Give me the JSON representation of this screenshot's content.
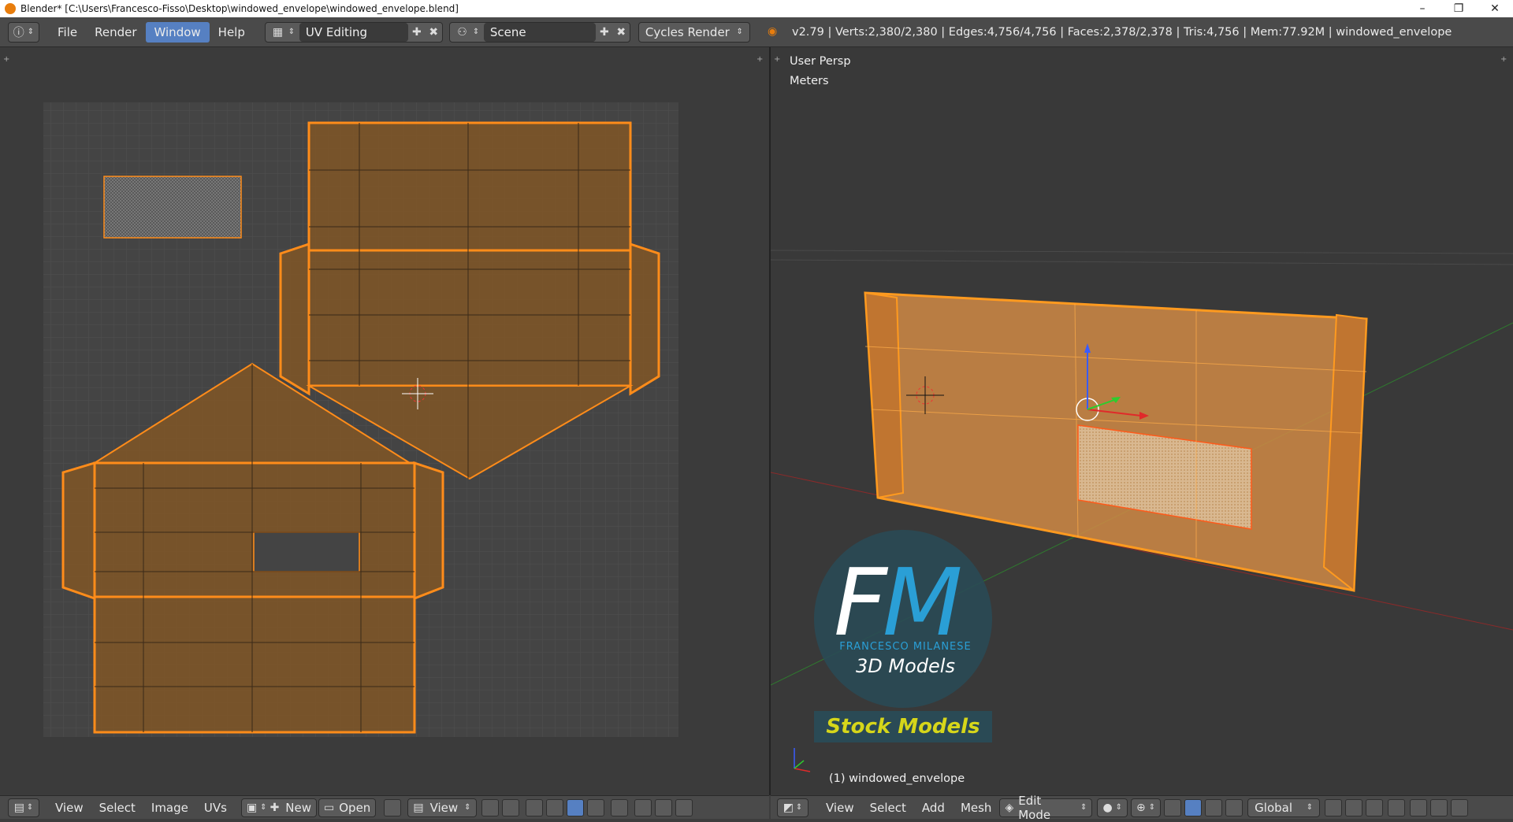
{
  "window": {
    "title": "Blender* [C:\\Users\\Francesco-Fisso\\Desktop\\windowed_envelope\\windowed_envelope.blend]",
    "controls": [
      "–",
      "❐",
      "✕"
    ]
  },
  "menu": {
    "items": [
      "File",
      "Render",
      "Window",
      "Help"
    ],
    "active": "Window"
  },
  "screen_layout": "UV Editing",
  "scene": "Scene",
  "render_engine": "Cycles Render",
  "stats": "v2.79 | Verts:2,380/2,380 | Edges:4,756/4,756 | Faces:2,378/2,378 | Tris:4,756 | Mem:77.92M | windowed_envelope",
  "viewport": {
    "view_name": "User Persp",
    "units": "Meters",
    "object_label": "(1) windowed_envelope"
  },
  "uv_editor_bar": {
    "view": "View",
    "select": "Select",
    "image": "Image",
    "uvs": "UVs",
    "new": "New",
    "open": "Open",
    "view2": "View"
  },
  "view3d_bar": {
    "view": "View",
    "select": "Select",
    "add": "Add",
    "mesh": "Mesh",
    "mode": "Edit Mode",
    "orientation": "Global"
  },
  "watermark": {
    "letters_f": "F",
    "letters_m": "M",
    "name": "FRANCESCO MILANESE",
    "models": "3D Models",
    "stock": "Stock Models"
  },
  "colors": {
    "selection_orange": "#ff8c1a",
    "uv_face_fill": "#8a5a2a",
    "active_menu": "#5680c2"
  }
}
